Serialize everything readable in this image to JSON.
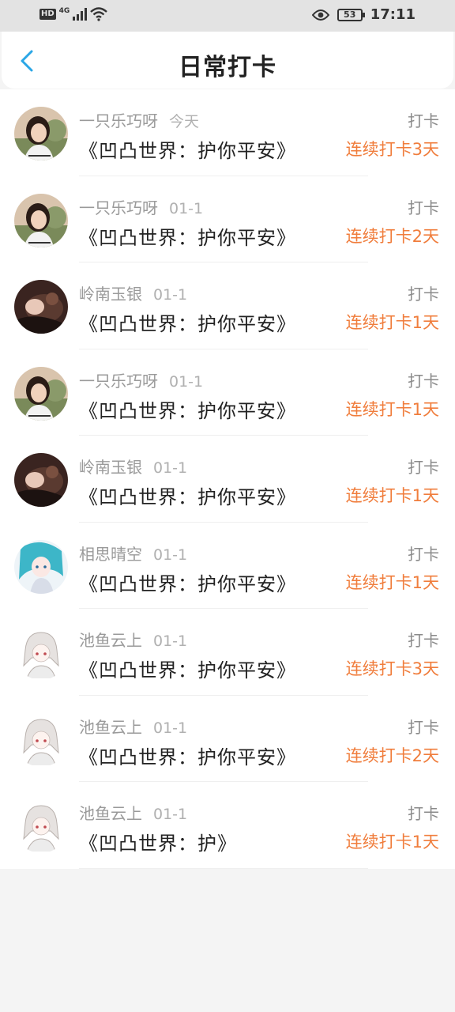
{
  "status_bar": {
    "hd": "HD",
    "network": "4G",
    "battery": "53",
    "time": "17:11"
  },
  "header": {
    "title": "日常打卡"
  },
  "colors": {
    "accent": "#2aa6e6",
    "streak": "#f07d3c"
  },
  "entries": [
    {
      "user": "一只乐巧呀",
      "date": "今天",
      "content": "《凹凸世界：护你平安》",
      "action": "打卡",
      "streak": "连续打卡3天",
      "avatar": "woman"
    },
    {
      "user": "一只乐巧呀",
      "date": "01-1",
      "content": "《凹凸世界：护你平安》",
      "action": "打卡",
      "streak": "连续打卡2天",
      "avatar": "woman"
    },
    {
      "user": "岭南玉银",
      "date": "01-1",
      "content": "《凹凸世界：护你平安》",
      "action": "打卡",
      "streak": "连续打卡1天",
      "avatar": "dark"
    },
    {
      "user": "一只乐巧呀",
      "date": "01-1",
      "content": "《凹凸世界：护你平安》",
      "action": "打卡",
      "streak": "连续打卡1天",
      "avatar": "woman"
    },
    {
      "user": "岭南玉银",
      "date": "01-1",
      "content": "《凹凸世界：护你平安》",
      "action": "打卡",
      "streak": "连续打卡1天",
      "avatar": "dark"
    },
    {
      "user": "相思晴空",
      "date": "01-1",
      "content": "《凹凸世界：护你平安》",
      "action": "打卡",
      "streak": "连续打卡1天",
      "avatar": "anime-blue"
    },
    {
      "user": "池鱼云上",
      "date": "01-1",
      "content": "《凹凸世界：护你平安》",
      "action": "打卡",
      "streak": "连续打卡3天",
      "avatar": "anime-sketch"
    },
    {
      "user": "池鱼云上",
      "date": "01-1",
      "content": "《凹凸世界：护你平安》",
      "action": "打卡",
      "streak": "连续打卡2天",
      "avatar": "anime-sketch"
    },
    {
      "user": "池鱼云上",
      "date": "01-1",
      "content": "《凹凸世界：护》",
      "action": "打卡",
      "streak": "连续打卡1天",
      "avatar": "anime-sketch"
    }
  ]
}
